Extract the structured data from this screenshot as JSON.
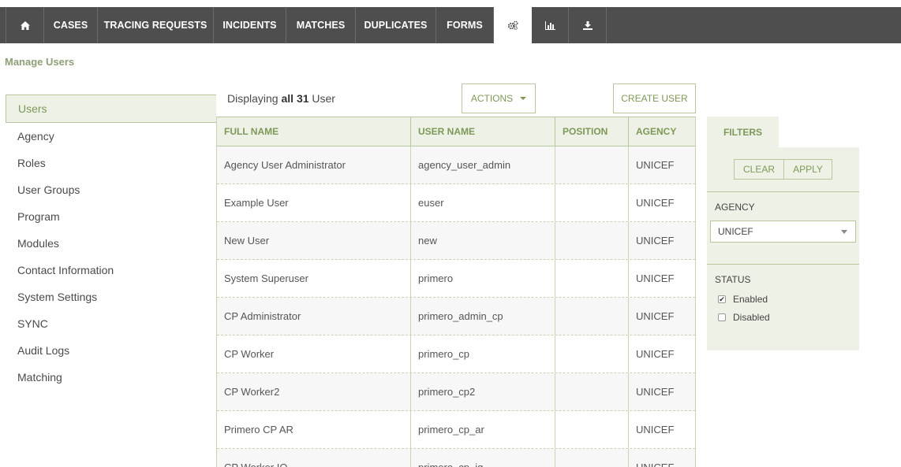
{
  "nav": {
    "tabs": [
      {
        "label": "",
        "icon": "home-icon"
      },
      {
        "label": "CASES"
      },
      {
        "label": "TRACING REQUESTS"
      },
      {
        "label": "INCIDENTS"
      },
      {
        "label": "MATCHES"
      },
      {
        "label": "DUPLICATES"
      },
      {
        "label": "FORMS"
      },
      {
        "label": "",
        "icon": "settings-icon",
        "active": true
      },
      {
        "label": "",
        "icon": "reports-icon"
      },
      {
        "label": "",
        "icon": "export-icon"
      }
    ]
  },
  "page": {
    "title": "Manage Users"
  },
  "sidebar": {
    "items": [
      {
        "label": "Users",
        "active": true
      },
      {
        "label": "Agency"
      },
      {
        "label": "Roles"
      },
      {
        "label": "User Groups"
      },
      {
        "label": "Program"
      },
      {
        "label": "Modules"
      },
      {
        "label": "Contact Information"
      },
      {
        "label": "System Settings"
      },
      {
        "label": "SYNC"
      },
      {
        "label": "Audit Logs"
      },
      {
        "label": "Matching"
      }
    ]
  },
  "list": {
    "display_prefix": "Displaying ",
    "display_count": "all 31",
    "display_suffix": " User",
    "actions_label": "ACTIONS",
    "create_label": "CREATE USER",
    "columns": [
      "FULL NAME",
      "USER NAME",
      "POSITION",
      "AGENCY"
    ],
    "rows": [
      {
        "full_name": "Agency User Administrator",
        "user_name": "agency_user_admin",
        "position": "",
        "agency": "UNICEF"
      },
      {
        "full_name": "Example User",
        "user_name": "euser",
        "position": "",
        "agency": "UNICEF"
      },
      {
        "full_name": "New User",
        "user_name": "new",
        "position": "",
        "agency": "UNICEF"
      },
      {
        "full_name": "System Superuser",
        "user_name": "primero",
        "position": "",
        "agency": "UNICEF"
      },
      {
        "full_name": "CP Administrator",
        "user_name": "primero_admin_cp",
        "position": "",
        "agency": "UNICEF"
      },
      {
        "full_name": "CP Worker",
        "user_name": "primero_cp",
        "position": "",
        "agency": "UNICEF"
      },
      {
        "full_name": "CP Worker2",
        "user_name": "primero_cp2",
        "position": "",
        "agency": "UNICEF"
      },
      {
        "full_name": "Primero CP AR",
        "user_name": "primero_cp_ar",
        "position": "",
        "agency": "UNICEF"
      },
      {
        "full_name": "CP Worker IQ",
        "user_name": "primero_cp_iq",
        "position": "",
        "agency": "UNICEF"
      }
    ]
  },
  "filters": {
    "tab_label": "FILTERS",
    "clear_label": "CLEAR",
    "apply_label": "APPLY",
    "agency_label": "AGENCY",
    "agency_value": "UNICEF",
    "status_label": "STATUS",
    "status_options": [
      {
        "label": "Enabled",
        "checked": true
      },
      {
        "label": "Disabled",
        "checked": false
      }
    ]
  },
  "colors": {
    "accent": "#7d9858",
    "nav_bg": "#4e4e4e",
    "panel_bg": "#eef2e6",
    "border": "#b7c69d"
  }
}
